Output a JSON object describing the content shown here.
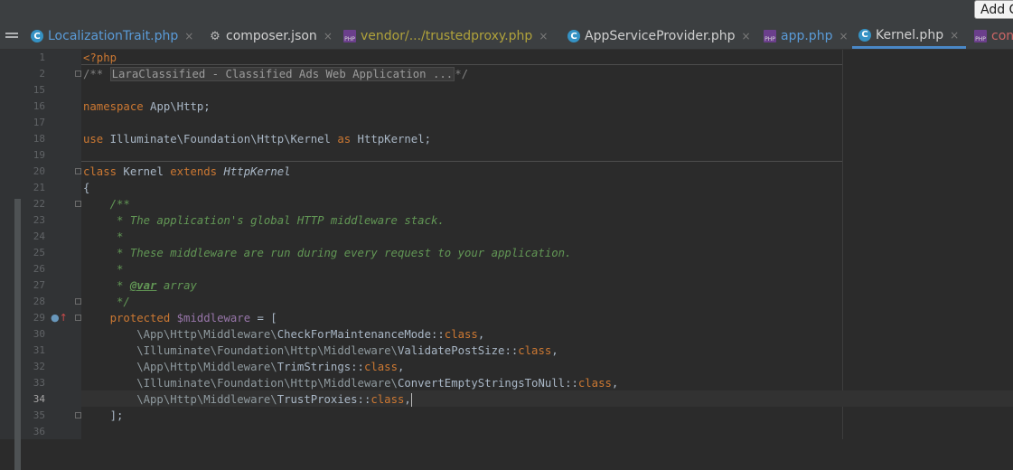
{
  "top_button": {
    "label": "Add C"
  },
  "tabs": [
    {
      "label": "LocalizationTrait.php",
      "icon": "class-icon",
      "close": "×"
    },
    {
      "label": "composer.json",
      "icon": "json-icon",
      "close": "×"
    },
    {
      "label": "vendor/.../trustedproxy.php",
      "icon": "php-file-icon",
      "close": "×"
    },
    {
      "label": "AppServiceProvider.php",
      "icon": "class-icon",
      "close": "×"
    },
    {
      "label": "app.php",
      "icon": "php-file-icon",
      "close": "×"
    },
    {
      "label": "Kernel.php",
      "icon": "class-icon",
      "close": "×",
      "active": true
    },
    {
      "label": "con",
      "icon": "php-file-icon"
    }
  ],
  "editor": {
    "current_line": 34,
    "lines": [
      {
        "n": "1",
        "segs": [
          [
            "kw",
            "<?php"
          ]
        ]
      },
      {
        "n": "2",
        "segs": [
          [
            "cmt",
            "/** "
          ],
          [
            "fold",
            "LaraClassified - Classified Ads Web Application ..."
          ],
          [
            "cmt",
            "*/"
          ]
        ]
      },
      {
        "n": "15",
        "segs": []
      },
      {
        "n": "16",
        "segs": [
          [
            "kw",
            "namespace"
          ],
          [
            "",
            "App\\Http;"
          ]
        ]
      },
      {
        "n": "17",
        "segs": []
      },
      {
        "n": "18",
        "segs": [
          [
            "kw",
            "use"
          ],
          [
            "",
            "Illuminate\\Foundation\\Http\\Kernel "
          ],
          [
            "kw",
            "as"
          ],
          [
            "",
            " HttpKernel;"
          ]
        ]
      },
      {
        "n": "19",
        "segs": []
      },
      {
        "n": "20",
        "segs": [
          [
            "kw",
            "class"
          ],
          [
            "",
            " Kernel "
          ],
          [
            "kw",
            "extends"
          ],
          [
            "it",
            "HttpKernel"
          ]
        ]
      },
      {
        "n": "21",
        "segs": [
          [
            "",
            "{"
          ]
        ]
      },
      {
        "n": "22",
        "segs": [
          [
            "cm",
            "    /**"
          ]
        ]
      },
      {
        "n": "23",
        "segs": [
          [
            "cm",
            "     * The application's global HTTP middleware stack."
          ]
        ]
      },
      {
        "n": "24",
        "segs": [
          [
            "cm",
            "     *"
          ]
        ]
      },
      {
        "n": "25",
        "segs": [
          [
            "cm",
            "     * These middleware are run during every request to your application."
          ]
        ]
      },
      {
        "n": "26",
        "segs": [
          [
            "cm",
            "     *"
          ]
        ]
      },
      {
        "n": "27",
        "segs": [
          [
            "cm",
            "     * "
          ],
          [
            "tag",
            "@var"
          ],
          [
            "cm",
            " array"
          ]
        ]
      },
      {
        "n": "28",
        "segs": [
          [
            "cm",
            "     */"
          ]
        ]
      },
      {
        "n": "29",
        "segs": [
          [
            "kw",
            "    protected "
          ],
          [
            "var",
            "$middleware"
          ],
          [
            "",
            " = ["
          ]
        ]
      },
      {
        "n": "30",
        "segs": [
          [
            "dim",
            "        \\App\\Http\\Middleware\\"
          ],
          [
            "",
            "CheckForMaintenanceMode"
          ],
          [
            "",
            "::"
          ],
          [
            "kw",
            "class"
          ],
          [
            "",
            ","
          ]
        ]
      },
      {
        "n": "31",
        "segs": [
          [
            "dim",
            "        \\Illuminate\\Foundation\\Http\\Middleware\\"
          ],
          [
            "",
            "ValidatePostSize"
          ],
          [
            "",
            "::"
          ],
          [
            "kw",
            "class"
          ],
          [
            "",
            ","
          ]
        ]
      },
      {
        "n": "32",
        "segs": [
          [
            "dim",
            "        \\App\\Http\\Middleware\\"
          ],
          [
            "",
            "TrimStrings"
          ],
          [
            "",
            "::"
          ],
          [
            "kw",
            "class"
          ],
          [
            "",
            ","
          ]
        ]
      },
      {
        "n": "33",
        "segs": [
          [
            "dim",
            "        \\Illuminate\\Foundation\\Http\\Middleware\\"
          ],
          [
            "",
            "ConvertEmptyStringsToNull"
          ],
          [
            "",
            "::"
          ],
          [
            "kw",
            "class"
          ],
          [
            "",
            ","
          ]
        ]
      },
      {
        "n": "34",
        "segs": [
          [
            "dim",
            "        \\App\\Http\\Middleware\\"
          ],
          [
            "",
            "TrustProxies"
          ],
          [
            "",
            "::"
          ],
          [
            "kw",
            "class"
          ],
          [
            "",
            ","
          ]
        ]
      },
      {
        "n": "35",
        "segs": [
          [
            "",
            "    ];"
          ]
        ]
      },
      {
        "n": "36",
        "segs": []
      }
    ]
  },
  "colors": {
    "keyword": "#cc7832",
    "comment": "#629755",
    "variable": "#9876aa",
    "text": "#a9b7c6",
    "active_tab_underline": "#4a88c7"
  }
}
